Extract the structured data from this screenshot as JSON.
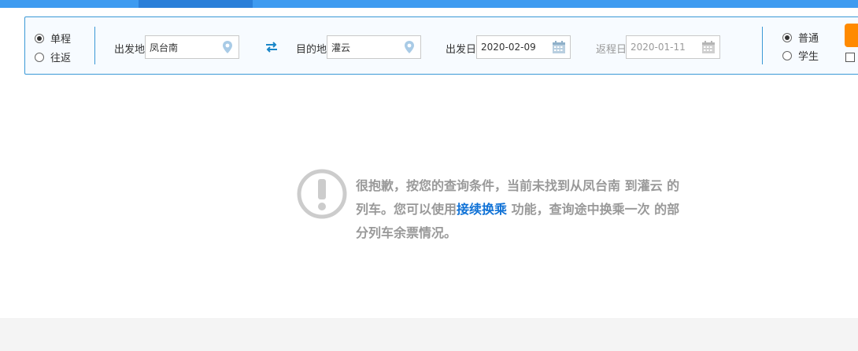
{
  "trip_type": {
    "options": [
      {
        "label": "单程",
        "selected": true
      },
      {
        "label": "往返",
        "selected": false
      }
    ]
  },
  "from": {
    "label": "出发地",
    "value": "凤台南",
    "icon": "location-pin-icon"
  },
  "to": {
    "label": "目的地",
    "value": "灌云",
    "icon": "location-pin-icon"
  },
  "swap_icon": "swap-arrows-icon",
  "depart_date": {
    "label": "出发日",
    "value": "2020-02-09",
    "icon": "calendar-icon"
  },
  "return_date": {
    "label": "返程日",
    "value": "2020-01-11",
    "icon": "calendar-icon",
    "disabled": true
  },
  "passenger_type": {
    "options": [
      {
        "label": "普通",
        "selected": true
      },
      {
        "label": "学生",
        "selected": false
      }
    ]
  },
  "notice": {
    "icon": "exclamation-circle-icon",
    "text_before": "很抱歉，按您的查询条件，当前未找到从凤台南 到灌云 的列车。您可以使用",
    "link": "接续换乘",
    "text_after": " 功能，查询途中换乘一次 的部分列车余票情况。"
  },
  "colors": {
    "accent": "#3b99d6",
    "top_bar": "#3e9bf0",
    "link": "#1072d6",
    "query_button": "#ff8a00",
    "notice_text": "#999999"
  }
}
